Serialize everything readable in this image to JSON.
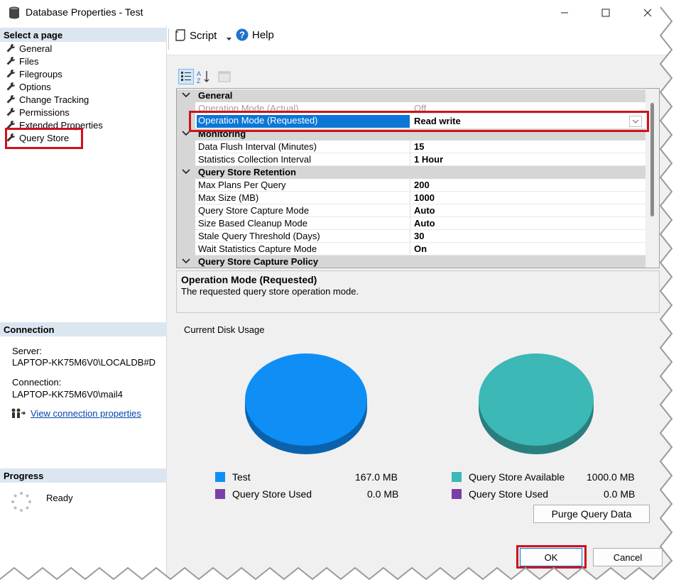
{
  "window": {
    "title": "Database Properties - Test"
  },
  "left": {
    "select_header": "Select a page",
    "pages": [
      {
        "label": "General"
      },
      {
        "label": "Files"
      },
      {
        "label": "Filegroups"
      },
      {
        "label": "Options"
      },
      {
        "label": "Change Tracking"
      },
      {
        "label": "Permissions"
      },
      {
        "label": "Extended Properties"
      },
      {
        "label": "Query Store"
      }
    ],
    "connection_header": "Connection",
    "server_label": "Server:",
    "server_value": "LAPTOP-KK75M6V0\\LOCALDB#D",
    "connection_label": "Connection:",
    "connection_value": "LAPTOP-KK75M6V0\\mail4",
    "view_link": "View connection properties",
    "progress_header": "Progress",
    "progress_status": "Ready"
  },
  "toolbar": {
    "script_label": "Script",
    "help_label": "Help"
  },
  "grid": {
    "cat_general": "General",
    "row_actual_name": "Operation Mode (Actual)",
    "row_actual_value": "Off",
    "row_requested_name": "Operation Mode (Requested)",
    "row_requested_value": "Read write",
    "cat_monitoring": "Monitoring",
    "row_flush_name": "Data Flush Interval (Minutes)",
    "row_flush_value": "15",
    "row_stats_name": "Statistics Collection Interval",
    "row_stats_value": "1 Hour",
    "cat_retention": "Query Store Retention",
    "row_maxplans_name": "Max Plans Per Query",
    "row_maxplans_value": "200",
    "row_maxsize_name": "Max Size (MB)",
    "row_maxsize_value": "1000",
    "row_capture_name": "Query Store Capture Mode",
    "row_capture_value": "Auto",
    "row_cleanup_name": "Size Based Cleanup Mode",
    "row_cleanup_value": "Auto",
    "row_stale_name": "Stale Query Threshold (Days)",
    "row_stale_value": "30",
    "row_wait_name": "Wait Statistics Capture Mode",
    "row_wait_value": "On",
    "cat_policy": "Query Store Capture Policy"
  },
  "description": {
    "title": "Operation Mode (Requested)",
    "text": "The requested query store operation mode."
  },
  "disk": {
    "title": "Current Disk Usage",
    "legend_test": "Test",
    "legend_test_value": "167.0 MB",
    "legend_used_left": "Query Store Used",
    "legend_used_left_value": "0.0 MB",
    "legend_available": "Query Store Available",
    "legend_available_value": "1000.0 MB",
    "legend_used_right": "Query Store Used",
    "legend_used_right_value": "0.0 MB",
    "purge_label": "Purge Query Data"
  },
  "footer": {
    "ok_label": "OK",
    "cancel_label": "Cancel"
  },
  "colors": {
    "blue_pie": "#0f8ff5",
    "teal_pie": "#3cb8b6",
    "used_purple": "#7a3fa8",
    "selection": "#0b77d6",
    "highlight_red": "#d0121b"
  }
}
